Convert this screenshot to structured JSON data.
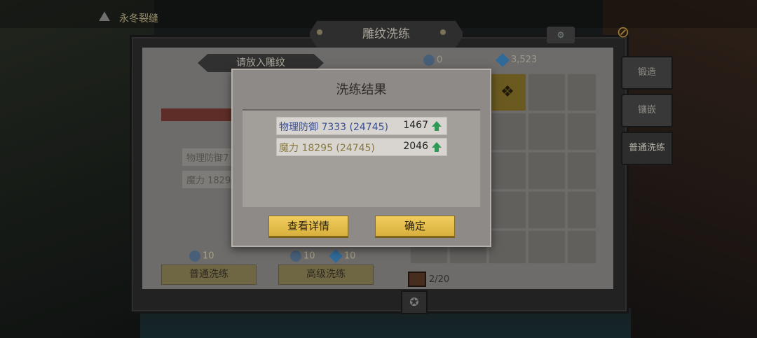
{
  "location": {
    "name": "永冬裂缝"
  },
  "window": {
    "title": "雕纹洗练"
  },
  "left_panel": {
    "slot_title": "请放入雕纹",
    "stats": [
      "物理防御7",
      "魔力 1829"
    ],
    "normal": {
      "cost": "10",
      "button": "普通洗练"
    },
    "advanced": {
      "cost_a": "10",
      "cost_b": "10",
      "button": "高级洗练"
    }
  },
  "resources": {
    "coins": "0",
    "gems": "3,523"
  },
  "inventory": {
    "count": "2/20"
  },
  "side_tabs": [
    "锻造",
    "镶嵌",
    "普通洗练"
  ],
  "modal": {
    "title": "洗练结果",
    "results": [
      {
        "label": "物理防御 7333 (24745)",
        "value": "1467",
        "label_color": "#3a4f8f"
      },
      {
        "label": "魔力 18295 (24745)",
        "value": "2046",
        "label_color": "#8a7a40"
      }
    ],
    "buttons": {
      "details": "查看详情",
      "confirm": "确定"
    }
  }
}
